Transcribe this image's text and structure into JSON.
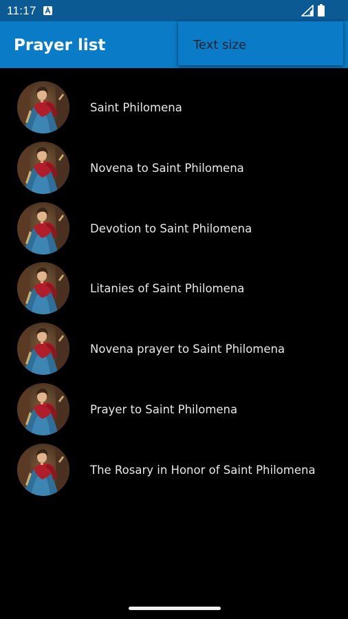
{
  "status_bar": {
    "time": "11:17",
    "icons": [
      "a-notification-icon",
      "signal-icon",
      "battery-icon"
    ]
  },
  "app_bar": {
    "title": "Prayer list",
    "background": "#0a7bc6"
  },
  "overflow_menu": {
    "items": [
      {
        "label": "Text size"
      }
    ]
  },
  "prayers": {
    "items": [
      {
        "label": "Saint Philomena",
        "icon": "saint-philomena-avatar"
      },
      {
        "label": "Novena to Saint Philomena",
        "icon": "saint-philomena-avatar"
      },
      {
        "label": "Devotion to Saint Philomena",
        "icon": "saint-philomena-avatar"
      },
      {
        "label": "Litanies of Saint Philomena",
        "icon": "saint-philomena-avatar"
      },
      {
        "label": "Novena prayer to Saint Philomena",
        "icon": "saint-philomena-avatar"
      },
      {
        "label": "Prayer to Saint Philomena",
        "icon": "saint-philomena-avatar"
      },
      {
        "label": "The Rosary in Honor of Saint Philomena",
        "icon": "saint-philomena-avatar"
      }
    ]
  },
  "colors": {
    "status_bar": "#0b5a94",
    "app_bar": "#0a7bc6",
    "background": "#000000",
    "text": "#e8e8e8"
  }
}
